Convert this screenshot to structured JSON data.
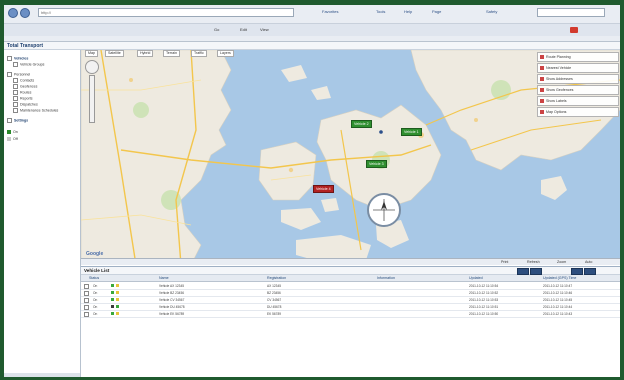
{
  "browser": {
    "address": "http://",
    "links": [
      "Favorites",
      "Tools",
      "Help",
      "Page",
      "Safety"
    ],
    "tools": [
      "Go",
      "Edit",
      "View"
    ]
  },
  "app": {
    "title": "Total Transport"
  },
  "sidebar": {
    "tree": [
      {
        "label": "Vehicles",
        "level": 0,
        "bold": true
      },
      {
        "label": "Vehicle Groups",
        "level": 1,
        "bold": false
      },
      {
        "label": "Personnel",
        "level": 0,
        "bold": false
      },
      {
        "label": "Contacts",
        "level": 1,
        "bold": false
      },
      {
        "label": "Geofences",
        "level": 1,
        "bold": false
      },
      {
        "label": "Routes",
        "level": 1,
        "bold": false
      },
      {
        "label": "Reports",
        "level": 1,
        "bold": false
      },
      {
        "label": "Dispatches",
        "level": 1,
        "bold": false
      },
      {
        "label": "Maintenance Schedules",
        "level": 1,
        "bold": false
      },
      {
        "label": "Settings",
        "level": 0,
        "bold": true
      }
    ],
    "legend": [
      {
        "label": "On",
        "color": "#2a8a2a"
      },
      {
        "label": "Off",
        "color": "#c8c8c8"
      }
    ]
  },
  "map": {
    "tabs": [
      "Map",
      "Satellite",
      "Hybrid",
      "Terrain",
      "Traffic",
      "Layers"
    ],
    "route_buttons": [
      "Route Planning",
      "Nearest Vehicle",
      "Show Addresses",
      "Show Geofences",
      "Show Labels",
      "Map Options"
    ],
    "vehicles": [
      {
        "label": "Vehicle 1",
        "color": "#2f8f2f"
      },
      {
        "label": "Vehicle 2",
        "color": "#2f8f2f"
      },
      {
        "label": "Vehicle 3",
        "color": "#2f8f2f"
      },
      {
        "label": "Vehicle 4",
        "color": "#b22222"
      }
    ],
    "provider": "Google",
    "bar_tools": [
      "Print",
      "Refresh",
      "Zoom",
      "Auto"
    ]
  },
  "panel": {
    "title": "Vehicle List",
    "columns": [
      "Status",
      "Name",
      "Registration",
      "Information",
      "Updated",
      "Updated (GPS) Time"
    ],
    "rows": [
      {
        "status": "On",
        "icons": [
          "#3aa83a",
          "#e7c53a"
        ],
        "name": "Vehicle AX 12345",
        "reg": "AX 12345",
        "info": "",
        "updated": "2011-10-12 11:10:54",
        "gps": "2011-10-12 11:10:47"
      },
      {
        "status": "On",
        "icons": [
          "#3aa83a",
          "#e7c53a"
        ],
        "name": "Vehicle BZ 23456",
        "reg": "BZ 23456",
        "info": "",
        "updated": "2011-10-12 11:10:52",
        "gps": "2011-10-12 11:10:46"
      },
      {
        "status": "On",
        "icons": [
          "#3aa83a",
          "#e7c53a"
        ],
        "name": "Vehicle CV 34567",
        "reg": "CV 34567",
        "info": "",
        "updated": "2011-10-12 11:10:53",
        "gps": "2011-10-12 11:10:45"
      },
      {
        "status": "On",
        "icons": [
          "#3a3a3a",
          "#3aa83a"
        ],
        "name": "Vehicle DU 45678",
        "reg": "DU 45678",
        "info": "",
        "updated": "2011-10-12 11:10:51",
        "gps": "2011-10-12 11:10:44"
      },
      {
        "status": "On",
        "icons": [
          "#3aa83a",
          "#e7c53a"
        ],
        "name": "Vehicle EK 56789",
        "reg": "EK 56789",
        "info": "",
        "updated": "2011-10-12 11:10:50",
        "gps": "2011-10-12 11:10:43"
      }
    ]
  }
}
